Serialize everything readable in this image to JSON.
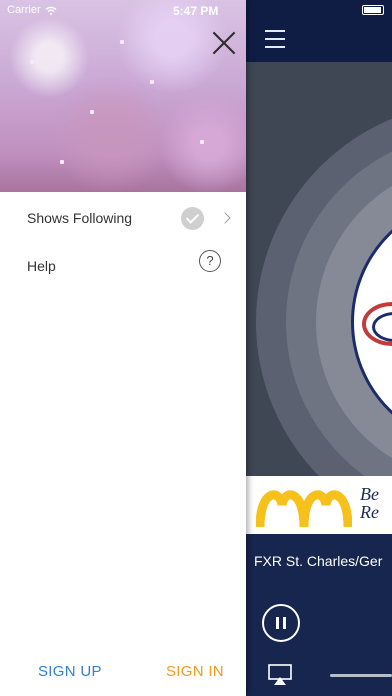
{
  "status_bar": {
    "carrier": "Carrier",
    "time": "5:47 PM"
  },
  "drawer": {
    "menu": [
      {
        "label": "Shows Following",
        "icon": "checkmark-circle-icon",
        "trailing_icon": "chevron-right-icon"
      },
      {
        "label": "Help",
        "icon": "question-circle-icon",
        "trailing_glyph": "?"
      }
    ],
    "footer": {
      "sign_up": "SIGN UP",
      "sign_in": "SIGN IN"
    }
  },
  "player": {
    "ad_text": "Be\nRe",
    "station_name": "FXR St. Charles/Ger"
  },
  "colors": {
    "drawer_bg": "#ffffff",
    "player_bg": "#16264f",
    "sign_up": "#2f82d3",
    "sign_in": "#f19a1c",
    "mcdonalds_yellow": "#f6c11b"
  }
}
